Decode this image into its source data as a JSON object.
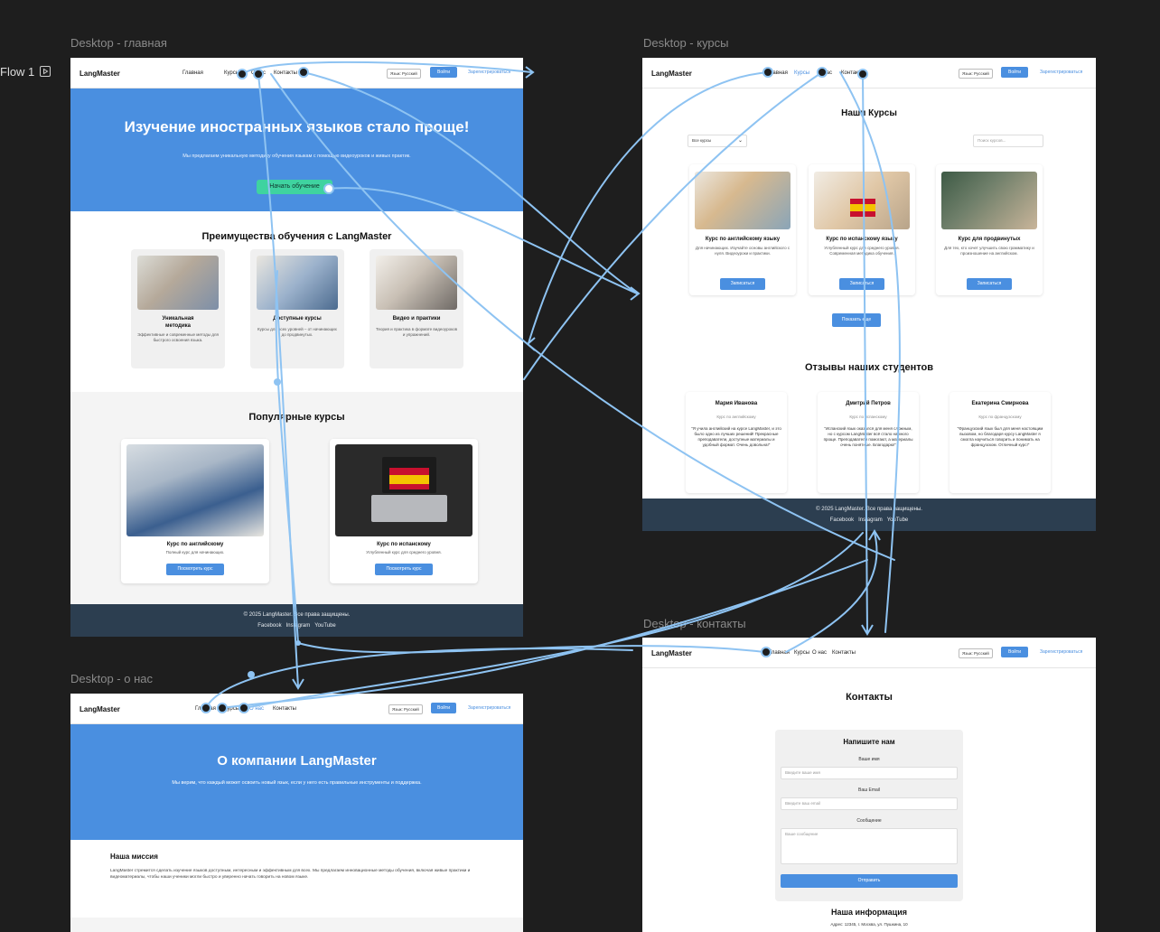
{
  "flow_label": "Flow 1",
  "frames": {
    "main": {
      "label": "Desktop - главная",
      "nav": {
        "logo": "LangMaster",
        "links": [
          "Главная",
          "Курсы",
          "О нас",
          "Контакты"
        ],
        "lang": "Язык: Русский",
        "login": "Войти",
        "register": "Зарегистрироваться"
      },
      "hero": {
        "title": "Изучение иностранных языков стало проще!",
        "subtitle": "Мы предлагаем уникальную методику обучения языкам с помощью видеоуроков и живых практик.",
        "cta": "Начать обучение"
      },
      "advantages": {
        "title": "Преимущества обучения с LangMaster",
        "cards": [
          {
            "title": "Уникальная методика",
            "desc": "Эффективные и современные методы для быстрого освоения языка."
          },
          {
            "title": "Доступные курсы",
            "desc": "Курсы для всех уровней – от начинающих до продвинутых."
          },
          {
            "title": "Видео и практики",
            "desc": "Теория и практика в формате видеоуроков и упражнений."
          }
        ]
      },
      "popular": {
        "title": "Популярные курсы",
        "cards": [
          {
            "title": "Курс по английскому",
            "desc": "Полный курс для начинающих.",
            "button": "Посмотреть курс"
          },
          {
            "title": "Курс по испанскому",
            "desc": "Углубленный курс для среднего уровня.",
            "button": "Посмотреть курс"
          }
        ]
      },
      "footer": {
        "copy": "© 2025 LangMaster. Все права защищены.",
        "links": [
          "Facebook",
          "Instagram",
          "YouTube"
        ]
      }
    },
    "courses": {
      "label": "Desktop - курсы",
      "nav": {
        "logo": "LangMaster",
        "links": [
          "Главная",
          "Курсы",
          "О нас",
          "Контакты"
        ],
        "lang": "Язык: Русский",
        "login": "Войти",
        "register": "Зарегистрироваться"
      },
      "title": "Наши Курсы",
      "filter": "Все курсы",
      "search_placeholder": "Поиск курсов...",
      "cards": [
        {
          "title": "Курс по английскому языку",
          "desc": "Для начинающих. Изучайте основы английского с нуля. Видеоуроки и практики.",
          "button": "Записаться"
        },
        {
          "title": "Курс по испанскому языку",
          "desc": "Углубленный курс для среднего уровня. Современная методика обучения.",
          "button": "Записаться"
        },
        {
          "title": "Курс для продвинутых",
          "desc": "Для тех, кто хочет улучшить свою грамматику и произношение на английском.",
          "button": "Записаться"
        }
      ],
      "show_more": "Показать еще",
      "reviews_title": "Отзывы наших студентов",
      "reviews": [
        {
          "name": "Мария Иванова",
          "course": "Курс по английскому",
          "text": "\"Я учила английский на курсе LangMaster, и это было одно из лучших решений! Прекрасные преподаватели, доступные материалы и удобный формат. Очень довольна!\""
        },
        {
          "name": "Дмитрий Петров",
          "course": "Курс по испанскому",
          "text": "\"Испанский язык оказался для меня сложным, но с курсом LangMaster всё стало намного проще. Преподаватели помогают, а материалы очень понятные. Благодарю!\""
        },
        {
          "name": "Екатерина Смирнова",
          "course": "Курс по французскому",
          "text": "\"Французский язык был для меня настоящим вызовом, но благодаря курсу LangMaster я смогла научиться говорить и понимать на французском. Отличный курс!\""
        }
      ],
      "footer": {
        "copy": "© 2025 LangMaster. Все права защищены.",
        "links": [
          "Facebook",
          "Instagram",
          "YouTube"
        ]
      }
    },
    "contacts": {
      "label": "Desktop - контакты",
      "nav": {
        "logo": "LangMaster",
        "links": [
          "Главная",
          "Курсы",
          "О нас",
          "Контакты"
        ],
        "lang": "Язык: Русский",
        "login": "Войти",
        "register": "Зарегистрироваться"
      },
      "title": "Контакты",
      "form": {
        "title": "Напишите нам",
        "name_label": "Ваше имя",
        "name_placeholder": "Введите ваше имя",
        "email_label": "Ваш Email",
        "email_placeholder": "Введите ваш email",
        "message_label": "Сообщение",
        "message_placeholder": "Ваше сообщение",
        "submit": "Отправить"
      },
      "info_title": "Наша информация",
      "address": "Адрес: 12345, г. Москва, ул. Пушкина, 10"
    },
    "about": {
      "label": "Desktop - о нас",
      "nav": {
        "logo": "LangMaster",
        "links": [
          "Главная",
          "Курсы",
          "О нас",
          "Контакты"
        ],
        "lang": "Язык: Русский",
        "login": "Войти",
        "register": "Зарегистрироваться"
      },
      "hero": {
        "title": "О компании LangMaster",
        "subtitle": "Мы верим, что каждый может освоить новый язык, если у него есть правильные инструменты и поддержка."
      },
      "mission_title": "Наша миссия",
      "mission_text": "LangMaster стремится сделать изучение языков доступным, интересным и эффективным для всех. Мы предлагаем инновационные методы обучения, включая живые практики и видеоматериалы, чтобы наши ученики могли быстро и уверенно начать говорить на новом языке."
    }
  },
  "colors": {
    "canvas": "#1e1e1e",
    "accent": "#4a8fe0",
    "footer": "#2c3e50",
    "flow": "#8ec3f2",
    "cta": "#3fd3a0"
  }
}
